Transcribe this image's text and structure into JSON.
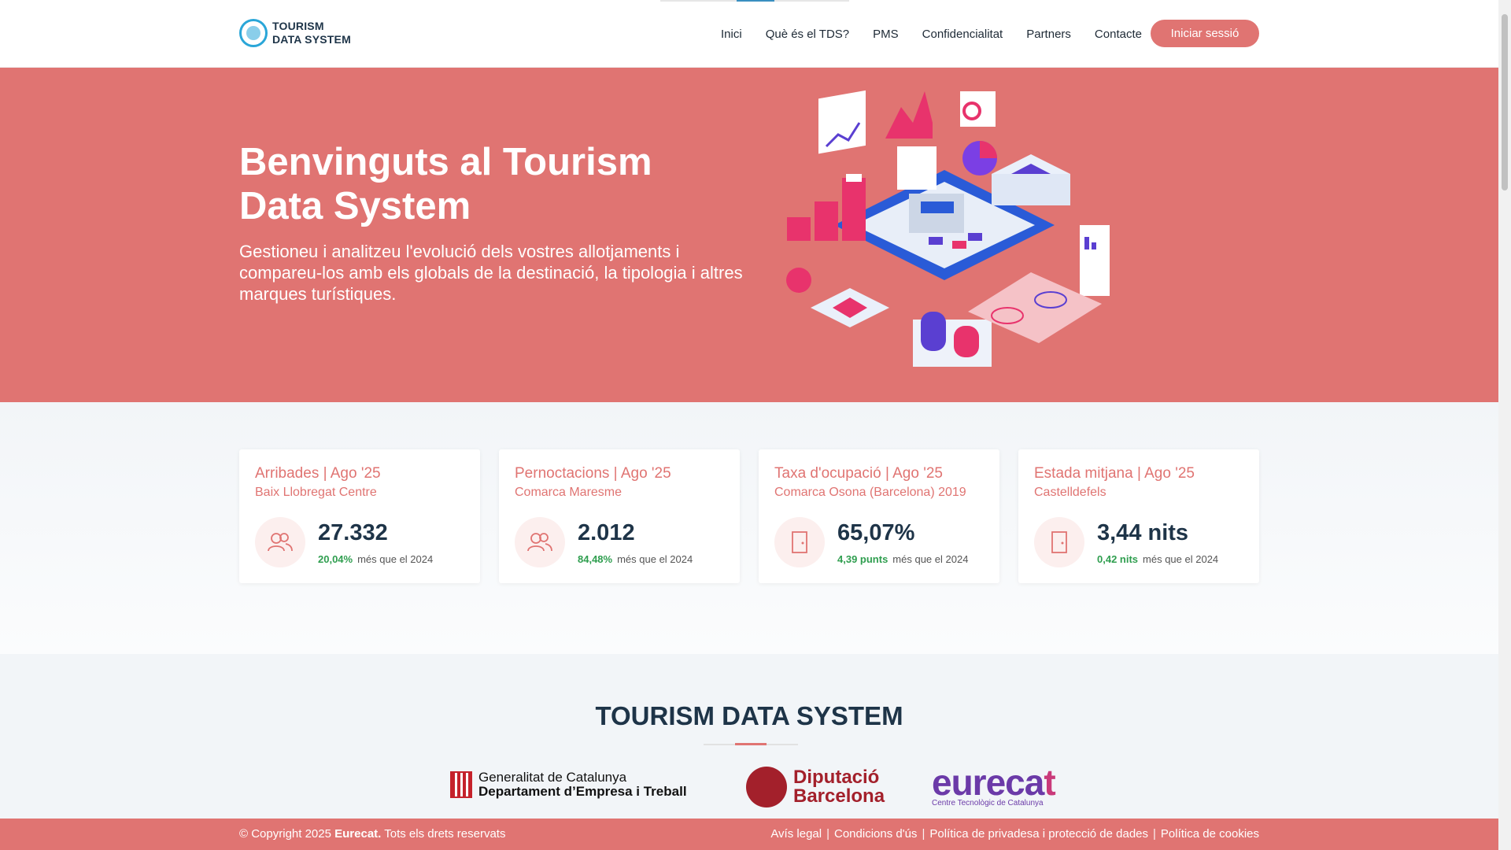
{
  "header": {
    "logo_line1": "TOURISM",
    "logo_line2": "DATA SYSTEM",
    "nav": [
      "Inici",
      "Què és el TDS?",
      "PMS",
      "Confidencialitat",
      "Partners",
      "Contacte"
    ],
    "login_label": "Iniciar sessió"
  },
  "hero": {
    "title": "Benvinguts al Tourism Data System",
    "subtitle": "Gestioneu i analitzeu l'evolució dels vostres allotjaments i compareu-los amb els globals de la destinació, la tipologia i altres marques turístiques."
  },
  "stats": [
    {
      "title": "Arribades | Ago '25",
      "sub": "Baix Llobregat Centre",
      "value": "27.332",
      "delta": "20,04%",
      "delta_text": "més que el 2024",
      "icon": "people-icon"
    },
    {
      "title": "Pernoctacions | Ago '25",
      "sub": "Comarca Maresme",
      "value": "2.012",
      "delta": "84,48%",
      "delta_text": "més que el 2024",
      "icon": "people-icon"
    },
    {
      "title": "Taxa d'ocupació | Ago '25",
      "sub": "Comarca Osona (Barcelona) 2019",
      "value": "65,07%",
      "delta": "4,39 punts",
      "delta_text": "més que el 2024",
      "icon": "door-icon"
    },
    {
      "title": "Estada mitjana | Ago '25",
      "sub": "Castelldefels",
      "value": "3,44 nits",
      "delta": "0,42 nits",
      "delta_text": "més que el 2024",
      "icon": "door-icon"
    }
  ],
  "partners": {
    "heading": "TOURISM DATA SYSTEM",
    "generalitat_line1": "Generalitat de Catalunya",
    "generalitat_line2": "Departament d’Empresa i Treball",
    "diputacio_line1": "Diputació",
    "diputacio_line2": "Barcelona",
    "eurecat_main": "eureca",
    "eurecat_t": "t",
    "eurecat_small": "Centre Tecnològic de Catalunya"
  },
  "footer": {
    "copyright_pre": "© Copyright 2025",
    "copyright_brand": "Eurecat.",
    "copyright_post": "Tots els drets reservats",
    "links": [
      "Avís legal",
      "Condicions d'ús",
      "Política de privadesa i protecció de dades",
      "Política de cookies"
    ]
  },
  "colors": {
    "accent": "#e07472",
    "dark": "#1e3448",
    "positive": "#2f9e4f"
  }
}
